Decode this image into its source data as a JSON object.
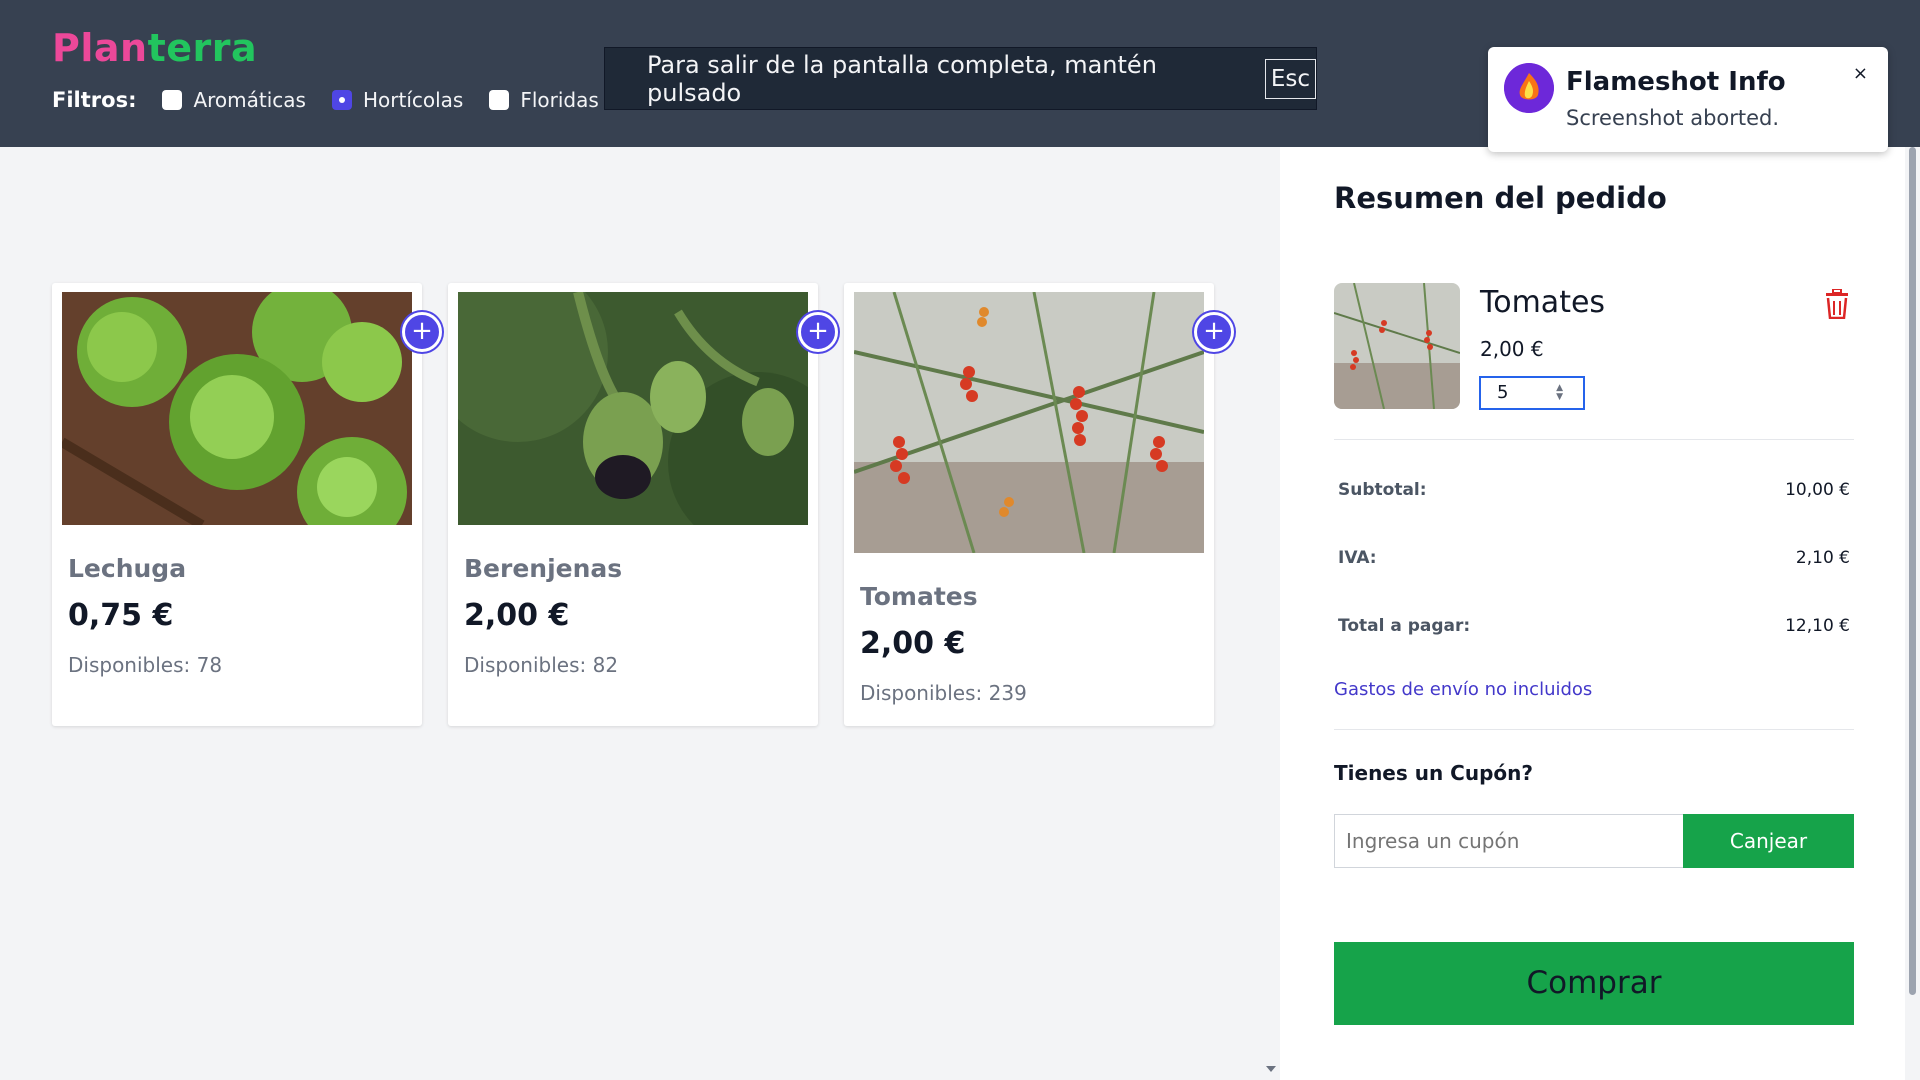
{
  "header": {
    "logo_part1": "Plan",
    "logo_part2": "terra",
    "filters_label": "Filtros:",
    "filters": [
      {
        "label": "Aromáticas",
        "checked": false
      },
      {
        "label": "Hortícolas",
        "checked": true
      },
      {
        "label": "Floridas",
        "checked": false
      }
    ],
    "colors": {
      "bg": "#374151",
      "logo_pink": "#ec4899",
      "logo_green": "#22c55e"
    }
  },
  "fullscreen_banner": {
    "text": "Para salir de la pantalla completa, mantén pulsado",
    "key": "Esc"
  },
  "products": [
    {
      "name": "Lechuga",
      "price": "0,75 €",
      "stock": "Disponibles: 78",
      "image": "lettuce-photo"
    },
    {
      "name": "Berenjenas",
      "price": "2,00 €",
      "stock": "Disponibles: 82",
      "image": "eggplant-photo"
    },
    {
      "name": "Tomates",
      "price": "2,00 €",
      "stock": "Disponibles: 239",
      "image": "tomato-photo"
    }
  ],
  "order": {
    "title": "Resumen del pedido",
    "item": {
      "name": "Tomates",
      "price": "2,00 €",
      "quantity": "5"
    },
    "subtotal_label": "Subtotal:",
    "subtotal": "10,00 €",
    "iva_label": "IVA:",
    "iva": "2,10 €",
    "total_label": "Total a pagar:",
    "total": "12,10 €",
    "shipping_note": "Gastos de envío no incluidos",
    "coupon_title": "Tienes un Cupón?",
    "coupon_placeholder": "Ingresa un cupón",
    "coupon_button": "Canjear",
    "buy_button": "Comprar",
    "colors": {
      "accent_green": "#16a34a",
      "link": "#4338ca",
      "trash": "#dc2626"
    }
  },
  "notification": {
    "title": "Flameshot Info",
    "message": "Screenshot aborted.",
    "close": "×"
  }
}
